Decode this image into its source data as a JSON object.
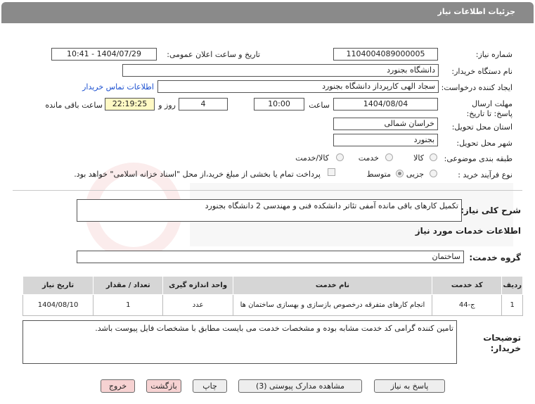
{
  "window": {
    "title": "جزئیات اطلاعات نیاز"
  },
  "form": {
    "need_number_label": "شماره نیاز:",
    "need_number": "1104004089000005",
    "announce_label": "تاریخ و ساعت اعلان عمومی:",
    "announce_value": "1404/07/29 - 10:41",
    "buyer_org_label": "نام دستگاه خریدار:",
    "buyer_org": "دانشگاه بجنورد",
    "creator_label": "ایجاد کننده درخواست:",
    "creator": "سجاد الهی کارپرداز دانشگاه بجنورد",
    "contact_link": "اطلاعات تماس خریدار",
    "deadline_label": "مهلت ارسال پاسخ: تا تاریخ:",
    "deadline_date": "1404/08/04",
    "time_label": "ساعت",
    "deadline_time": "10:00",
    "days_value": "4",
    "days_label": "روز و",
    "remaining_time": "22:19:25",
    "remaining_label": "ساعت باقی مانده",
    "province_label": "استان محل تحویل:",
    "province": "خراسان شمالی",
    "city_label": "شهر محل تحویل:",
    "city": "بجنورد",
    "category_label": "طبقه بندی موضوعی:",
    "category_options": [
      "کالا",
      "خدمت",
      "کالا/خدمت"
    ],
    "process_label": "نوع فرآیند خرید :",
    "process_options": [
      "جزیی",
      "متوسط"
    ],
    "payment_note": "پرداخت تمام یا بخشی از مبلغ خرید،از محل \"اسناد خزانه اسلامی\" خواهد بود."
  },
  "description": {
    "label": "شرح کلی نیاز:",
    "value": "تکمیل کارهای باقی مانده آمفی تئاتر دانشکده فنی و مهندسی 2 دانشگاه بجنورد"
  },
  "services": {
    "section_title": "اطلاعات خدمات مورد نیاز",
    "group_label": "گروه خدمت:",
    "group_value": "ساختمان",
    "columns": [
      "ردیف",
      "کد خدمت",
      "نام خدمت",
      "واحد اندازه گیری",
      "تعداد / مقدار",
      "تاریخ نیاز"
    ],
    "rows": [
      {
        "index": "1",
        "code": "ج-44",
        "name": "انجام کارهای متفرقه درخصوص بازسازی و بهسازی ساختمان ها",
        "unit": "عدد",
        "qty": "1",
        "date": "1404/08/10"
      }
    ]
  },
  "notes": {
    "label": "توضیحات خریدار:",
    "value": "تامین کننده گرامی کد خدمت مشابه بوده و مشخصات خدمت می بایست مطابق با مشخصات فایل پیوست باشد."
  },
  "buttons": {
    "respond": "پاسخ به نیاز",
    "attachments": "مشاهده مدارک پیوستی (3)",
    "print": "چاپ",
    "back": "بازگشت",
    "exit": "خروج"
  },
  "colors": {
    "titlebar": "#8a8a8a",
    "accent_link": "#1a4fd0",
    "highlight": "#fff9c4",
    "danger_button": "#f6d2d2"
  }
}
